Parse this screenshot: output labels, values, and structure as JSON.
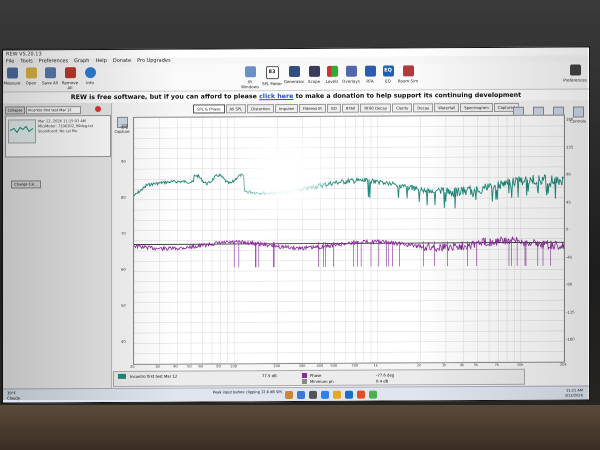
{
  "window": {
    "title": "REW V5.20.13"
  },
  "menu": [
    "File",
    "Tools",
    "Preferences",
    "Graph",
    "Help",
    "Donate",
    "Pro Upgrades"
  ],
  "toolbar": {
    "left": [
      {
        "label": "Measure",
        "icon": "microphone-icon"
      },
      {
        "label": "Open",
        "icon": "folder-icon"
      },
      {
        "label": "Save All",
        "icon": "save-icon"
      },
      {
        "label": "Remove All",
        "icon": "remove-icon"
      },
      {
        "label": "Info",
        "icon": "info-icon"
      }
    ],
    "center": [
      {
        "label": "IR Windows",
        "icon": "ir-windows-icon"
      },
      {
        "label": "SPL Meter",
        "icon": "spl-meter-icon",
        "value": "83"
      },
      {
        "label": "Generator",
        "icon": "generator-icon"
      },
      {
        "label": "Scope",
        "icon": "scope-icon"
      },
      {
        "label": "Levels",
        "icon": "levels-icon"
      },
      {
        "label": "Overlays",
        "icon": "overlays-icon"
      },
      {
        "label": "RTA",
        "icon": "rta-icon"
      },
      {
        "label": "EQ",
        "icon": "eq-icon"
      },
      {
        "label": "Room Sim",
        "icon": "room-sim-icon"
      }
    ],
    "right": {
      "label": "Preferences",
      "icon": "preferences-icon"
    }
  },
  "banner": {
    "before": "REW is free software, but if you can afford to please ",
    "link": "click here",
    "after": " to make a donation to help support its continuing development"
  },
  "left_panel": {
    "collapse_label": "Collapse",
    "name_field": "Incontro first test Mar 12",
    "measurement": {
      "line1": "Mar 12, 2026 11:15:03 AM",
      "line2": "Mic/Meter: 7106302_90deg.txt",
      "line3": "Soundcard: No cal file"
    },
    "change_cal_label": "Change Cal..."
  },
  "tabs": [
    "SPL & Phase",
    "All SPL",
    "Distortion",
    "Impulse",
    "Filtered IR",
    "GD",
    "RT60",
    "RT60 Decay",
    "Clarity",
    "Decay",
    "Waterfall",
    "Spectrogram",
    "Captured"
  ],
  "active_tab": "SPL & Phase",
  "right_buttons": [
    "Scroll Bars",
    "Freq. Axis",
    "Limits",
    "Controls"
  ],
  "capture_label": "Capture",
  "spl_axis_label": "SPL",
  "spl_ticks": [
    "100",
    "90",
    "80",
    "70",
    "60",
    "50",
    "40"
  ],
  "phase_ticks": [
    "180",
    "135",
    "90",
    "45",
    "0",
    "-45",
    "-90",
    "-135",
    "-180"
  ],
  "x_ticks": [
    "20",
    "30",
    "40",
    "50",
    "60",
    "80",
    "100",
    "200",
    "300",
    "400",
    "500",
    "700",
    "1k",
    "2k",
    "3k",
    "4k",
    "5k",
    "7k",
    "10k",
    "20k"
  ],
  "bottom_bar": {
    "trace_name": "Incontro first test Mar 12",
    "spl_value": "77.5 dB",
    "phase_label": "Phase",
    "phase_value": "-77.6 deg",
    "minimum_label": "Minimum ph",
    "min_value": "0.4 dB"
  },
  "status_bar": "Peak input before clipping 12.6 dB SPL",
  "taskbar": {
    "weather_temp": "39°F",
    "weather_label": "Cloudy",
    "time": "11:21 AM",
    "date": "3/12/2026"
  },
  "colors": {
    "spl_trace": "#1f8a7a",
    "phase_trace": "#8a2a9a",
    "link": "#1a4fd6",
    "grid": "#d9d9d9"
  }
}
